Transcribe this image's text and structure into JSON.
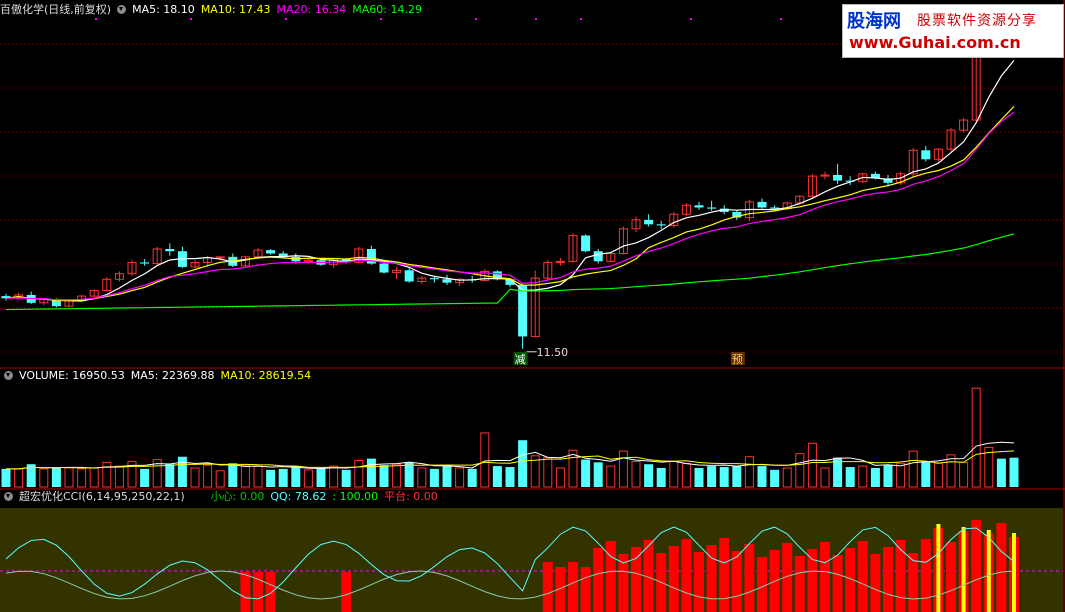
{
  "main_panel": {
    "title": "百傲化学(日线,前复权)",
    "ma5": "MA5: 18.10",
    "ma10": "MA10: 17.43",
    "ma20": "MA20: 16.34",
    "ma60": "MA60: 14.29",
    "low_label": "11.50",
    "marker_reduce": "减",
    "marker_pre": "预"
  },
  "volume_panel": {
    "volume": "VOLUME: 16950.53",
    "ma5": "MA5: 22369.88",
    "ma10": "MA10: 28619.54"
  },
  "cci_panel": {
    "title": "超宏优化CCI(6,14,95,250,22,1)",
    "xiaoxin": "小心: 0.00",
    "qq": "QQ: 78.62",
    "blank": ": 100.00",
    "pingtai": "平台: 0.00"
  },
  "watermark": {
    "brand": "股海网",
    "slogan": "股票软件资源分享",
    "url": "www.Guhai.com.cn"
  },
  "colors": {
    "up": "#ff3232",
    "down": "#54ffff",
    "ma5": "#ffffff",
    "ma10": "#ffff00",
    "ma20": "#ff00ff",
    "ma60": "#00ff00",
    "grid": "#8b0000",
    "cci_bg": "#333300"
  },
  "chart_data": {
    "type": "candlestick",
    "candles": [
      [
        16.2,
        16.4,
        15.8,
        16.0
      ],
      [
        16.0,
        16.5,
        15.9,
        16.3
      ],
      [
        16.3,
        16.6,
        15.5,
        15.6
      ],
      [
        15.6,
        16.0,
        15.4,
        15.9
      ],
      [
        15.9,
        16.0,
        15.2,
        15.3
      ],
      [
        15.3,
        15.9,
        15.2,
        15.8
      ],
      [
        15.8,
        16.3,
        15.7,
        16.2
      ],
      [
        16.2,
        16.8,
        16.1,
        16.7
      ],
      [
        16.7,
        17.9,
        16.6,
        17.7
      ],
      [
        17.7,
        18.4,
        17.5,
        18.2
      ],
      [
        18.2,
        19.4,
        18.0,
        19.2
      ],
      [
        19.2,
        19.5,
        18.9,
        19.1
      ],
      [
        19.1,
        20.6,
        19.0,
        20.4
      ],
      [
        20.4,
        20.9,
        19.8,
        20.2
      ],
      [
        20.2,
        20.6,
        18.7,
        18.8
      ],
      [
        18.8,
        19.4,
        18.7,
        19.2
      ],
      [
        19.2,
        19.8,
        18.8,
        19.6
      ],
      [
        19.6,
        19.8,
        19.4,
        19.7
      ],
      [
        19.7,
        20.0,
        18.8,
        18.9
      ],
      [
        18.9,
        19.8,
        18.8,
        19.7
      ],
      [
        19.7,
        20.5,
        19.6,
        20.3
      ],
      [
        20.3,
        20.4,
        19.9,
        20.0
      ],
      [
        20.0,
        20.2,
        19.6,
        19.7
      ],
      [
        19.7,
        20.0,
        19.1,
        19.3
      ],
      [
        19.3,
        19.6,
        19.1,
        19.4
      ],
      [
        19.4,
        19.6,
        18.9,
        19.0
      ],
      [
        19.0,
        19.6,
        18.7,
        19.5
      ],
      [
        19.5,
        19.6,
        19.1,
        19.2
      ],
      [
        19.2,
        20.6,
        19.1,
        20.4
      ],
      [
        20.4,
        20.7,
        19.0,
        19.1
      ],
      [
        19.1,
        19.2,
        18.2,
        18.3
      ],
      [
        18.3,
        18.8,
        17.7,
        18.5
      ],
      [
        18.5,
        18.7,
        17.4,
        17.5
      ],
      [
        17.5,
        18.0,
        17.3,
        17.8
      ],
      [
        17.8,
        18.0,
        17.4,
        17.7
      ],
      [
        17.7,
        18.1,
        17.2,
        17.4
      ],
      [
        17.4,
        17.8,
        17.1,
        17.7
      ],
      [
        17.7,
        18.0,
        17.4,
        17.6
      ],
      [
        17.6,
        18.6,
        17.5,
        18.4
      ],
      [
        18.4,
        18.5,
        17.6,
        17.7
      ],
      [
        17.7,
        17.8,
        17.0,
        17.2
      ],
      [
        17.2,
        17.3,
        11.5,
        12.6
      ],
      [
        12.6,
        18.5,
        12.5,
        17.8
      ],
      [
        17.8,
        19.4,
        17.6,
        19.2
      ],
      [
        19.2,
        19.6,
        18.9,
        19.3
      ],
      [
        19.3,
        21.8,
        19.2,
        21.6
      ],
      [
        21.6,
        21.7,
        20.1,
        20.2
      ],
      [
        20.2,
        20.4,
        19.1,
        19.3
      ],
      [
        19.3,
        20.1,
        19.2,
        20.0
      ],
      [
        20.0,
        22.4,
        19.9,
        22.2
      ],
      [
        22.2,
        23.3,
        21.9,
        23.0
      ],
      [
        23.0,
        23.5,
        22.4,
        22.6
      ],
      [
        22.6,
        22.9,
        22.2,
        22.5
      ],
      [
        22.5,
        23.7,
        22.3,
        23.5
      ],
      [
        23.5,
        24.5,
        23.3,
        24.3
      ],
      [
        24.3,
        24.6,
        23.9,
        24.1
      ],
      [
        24.1,
        24.7,
        23.8,
        24.0
      ],
      [
        24.0,
        24.3,
        23.5,
        23.7
      ],
      [
        23.7,
        23.9,
        23.0,
        23.2
      ],
      [
        23.2,
        24.8,
        22.9,
        24.6
      ],
      [
        24.6,
        24.9,
        24.0,
        24.1
      ],
      [
        24.1,
        24.3,
        23.8,
        24.0
      ],
      [
        24.0,
        24.6,
        23.9,
        24.5
      ],
      [
        24.5,
        25.2,
        24.3,
        25.1
      ],
      [
        25.1,
        27.1,
        24.9,
        26.9
      ],
      [
        26.9,
        27.3,
        26.6,
        27.0
      ],
      [
        27.0,
        28.0,
        26.2,
        26.5
      ],
      [
        26.5,
        26.9,
        26.1,
        26.4
      ],
      [
        26.4,
        27.2,
        26.3,
        27.1
      ],
      [
        27.1,
        27.3,
        26.6,
        26.7
      ],
      [
        26.7,
        27.0,
        26.0,
        26.3
      ],
      [
        26.3,
        27.3,
        26.1,
        27.1
      ],
      [
        27.1,
        29.4,
        26.9,
        29.2
      ],
      [
        29.2,
        29.6,
        28.2,
        28.4
      ],
      [
        28.4,
        29.4,
        28.2,
        29.3
      ],
      [
        29.3,
        31.2,
        29.1,
        31.0
      ],
      [
        31.0,
        32.1,
        30.8,
        31.9
      ],
      [
        31.9,
        37.9,
        31.7,
        37.7
      ],
      [
        37.7,
        40.1,
        37.5,
        39.8
      ],
      [
        39.8,
        40.3,
        38.6,
        38.8
      ],
      [
        38.8,
        39.4,
        37.6,
        37.9
      ]
    ],
    "low_marker_value": 11.5,
    "volume_ma_values": {
      "vol": 16950.53,
      "ma5": 22369.88,
      "ma10": 28619.54
    },
    "ylim": [
      10.5,
      41
    ]
  }
}
